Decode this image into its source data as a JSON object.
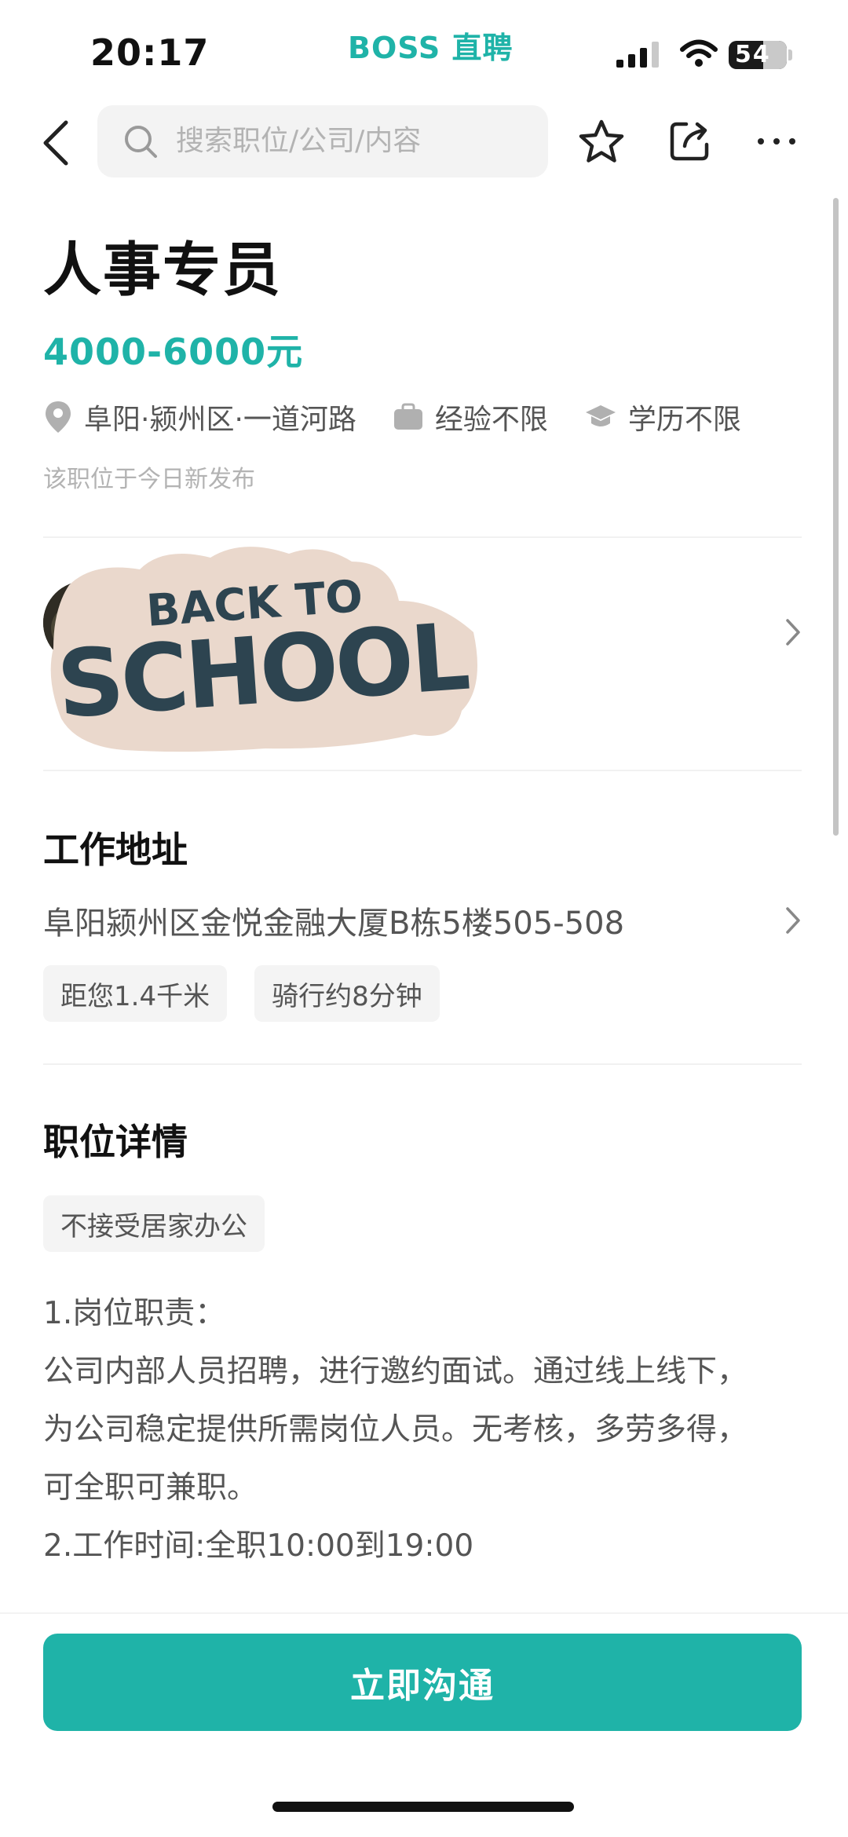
{
  "status_bar": {
    "time": "20:17",
    "brand": "BOSS 直聘",
    "battery": "54"
  },
  "nav": {
    "search_placeholder": "搜索职位/公司/内容"
  },
  "job": {
    "title": "人事专员",
    "salary": "4000-6000元",
    "location": "阜阳·颍州区·一道河路",
    "experience": "经验不限",
    "education": "学历不限",
    "published": "该职位于今日新发布"
  },
  "banner": {
    "sticker_line1": "BACK TO",
    "sticker_line2": "SCHOOL"
  },
  "work_address": {
    "title": "工作地址",
    "address": "阜阳颍州区金悦金融大厦B栋5楼505-508",
    "distance": "距您1.4千米",
    "ride_time": "骑行约8分钟"
  },
  "details": {
    "title": "职位详情",
    "tag": "不接受居家办公",
    "lines": [
      "1.岗位职责：",
      "公司内部人员招聘，进行邀约面试。通过线上线下，",
      "为公司稳定提供所需岗位人员。无考核，多劳多得，",
      "可全职可兼职。",
      "",
      "2.工作时间:全职10:00到19:00"
    ]
  },
  "cta": {
    "label": "立即沟通"
  },
  "colors": {
    "accent": "#1fb3a8",
    "text": "#111111",
    "muted": "#b3b3b3"
  }
}
